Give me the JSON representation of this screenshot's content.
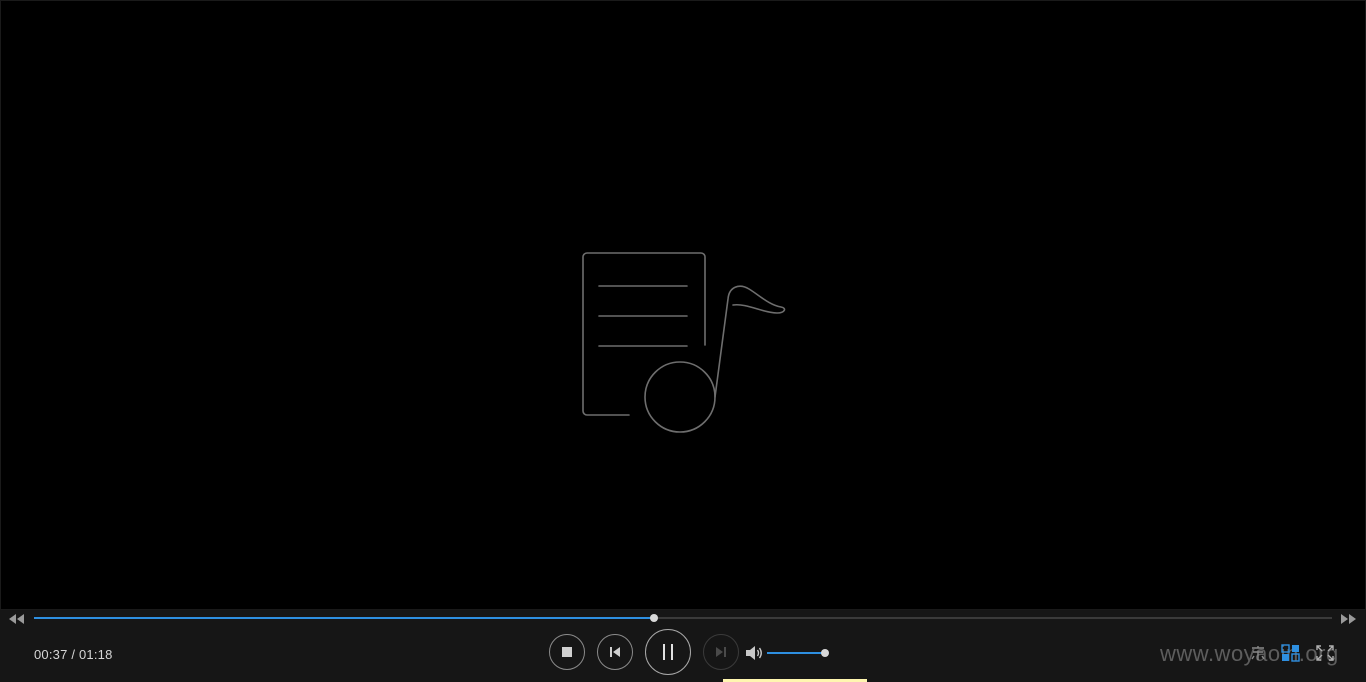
{
  "player": {
    "current_time": "00:37",
    "separator": "/",
    "total_time": "01:18",
    "progress_fraction": 0.478,
    "volume_fraction": 0.97
  },
  "watermark": {
    "text": "www.woyaoin.org"
  },
  "icons": {
    "seek_back": "rewind-icon",
    "seek_forward": "fast-forward-icon",
    "stop": "stop-icon",
    "previous": "previous-track-icon",
    "pause": "pause-icon",
    "next": "next-track-icon",
    "volume": "speaker-icon",
    "subtitle": "subtitle-icon",
    "layout": "layout-grid-icon",
    "fullscreen": "fullscreen-icon",
    "placeholder": "music-document-icon"
  },
  "colors": {
    "accent": "#2e8fe0",
    "background": "#000000",
    "control_bar": "#161616",
    "text": "#d6d6d6"
  }
}
